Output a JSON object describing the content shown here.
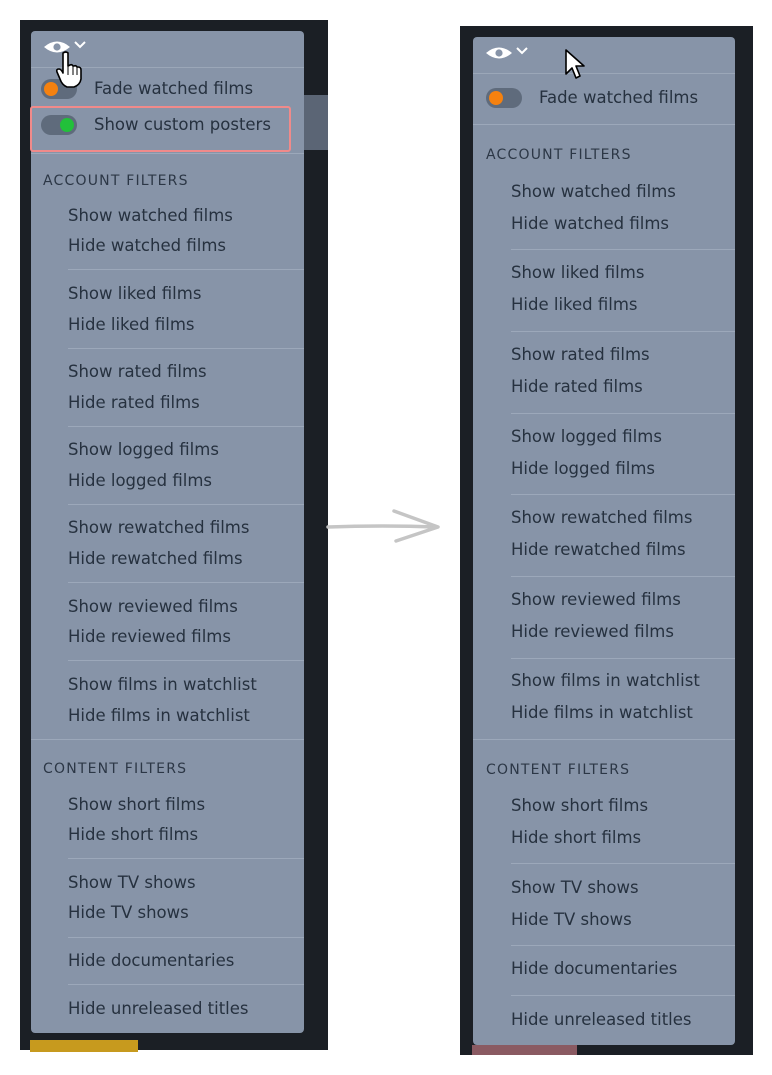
{
  "toggles": {
    "fade_watched": "Fade watched films",
    "custom_posters": "Show custom posters"
  },
  "account_filters": {
    "heading": "ACCOUNT FILTERS",
    "groups": [
      [
        "Show watched films",
        "Hide watched films"
      ],
      [
        "Show liked films",
        "Hide liked films"
      ],
      [
        "Show rated films",
        "Hide rated films"
      ],
      [
        "Show logged films",
        "Hide logged films"
      ],
      [
        "Show rewatched films",
        "Hide rewatched films"
      ],
      [
        "Show reviewed films",
        "Hide reviewed films"
      ],
      [
        "Show films in watchlist",
        "Hide films in watchlist"
      ]
    ]
  },
  "content_filters": {
    "heading": "CONTENT FILTERS",
    "groups": [
      [
        "Show short films",
        "Hide short films"
      ],
      [
        "Show TV shows",
        "Hide TV shows"
      ],
      [
        "Hide documentaries"
      ],
      [
        "Hide unreleased titles"
      ]
    ]
  },
  "colors": {
    "panel": "#8794a8",
    "toggle_on": "#22c03a",
    "toggle_accent": "#f5810f",
    "highlight": "#f08a8a"
  }
}
